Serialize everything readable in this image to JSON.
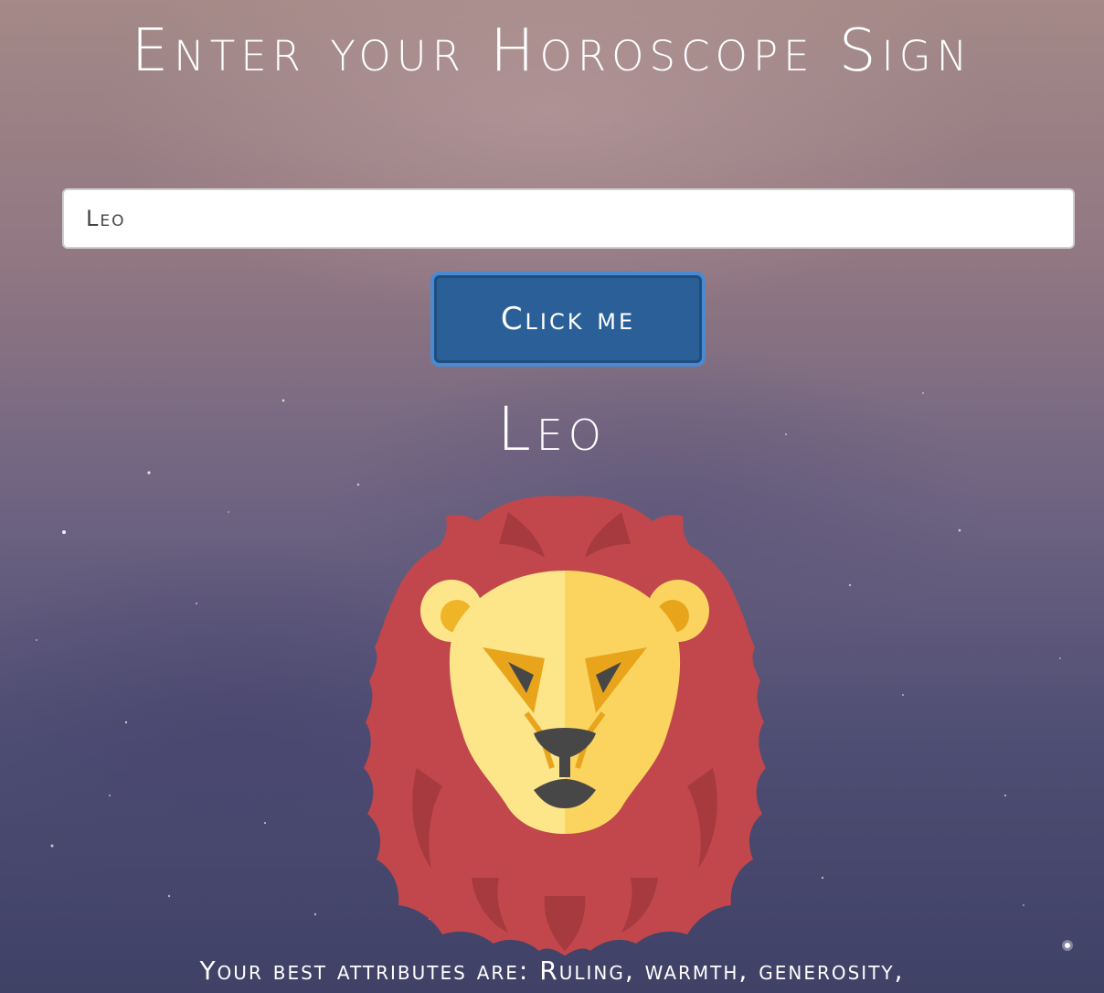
{
  "header": {
    "title": "Enter your Horoscope Sign"
  },
  "form": {
    "input_value": "Leo",
    "button_label": "Click me"
  },
  "result": {
    "sign_name": "Leo",
    "image_icon": "lion-icon",
    "attributes_text": "Your best attributes are: Ruling, warmth, generosity,"
  },
  "colors": {
    "button": "#2a6097",
    "mane": "#c1474c",
    "face": "#fde68a",
    "face_shade": "#fbd460",
    "accent": "#e8a51b",
    "nose": "#474747"
  }
}
